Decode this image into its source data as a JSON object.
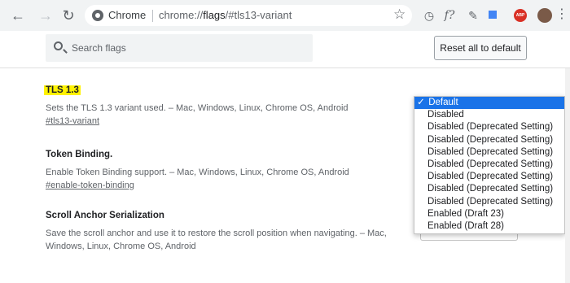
{
  "browser": {
    "site_name": "Chrome",
    "url_scheme": "chrome://",
    "url_host": "flags",
    "url_path": "/#tls13-variant",
    "extension_abp_label": "ABP"
  },
  "header": {
    "search_placeholder": "Search flags",
    "reset_label": "Reset all to default"
  },
  "flags": [
    {
      "title": "TLS 1.3",
      "description": "Sets the TLS 1.3 variant used. – Mac, Windows, Linux, Chrome OS, Android",
      "link": "#tls13-variant",
      "highlighted": true
    },
    {
      "title": "Token Binding.",
      "description": "Enable Token Binding support. – Mac, Windows, Linux, Chrome OS, Android",
      "link": "#enable-token-binding",
      "highlighted": false
    },
    {
      "title": "Scroll Anchor Serialization",
      "description_line1": "Save the scroll anchor and use it to restore the scroll position when navigating. – Mac,",
      "description_line2": "Windows, Linux, Chrome OS, Android",
      "highlighted": false
    }
  ],
  "dropdown": {
    "selected_check": "✓",
    "options": [
      "Default",
      "Disabled",
      "Disabled (Deprecated Setting)",
      "Disabled (Deprecated Setting)",
      "Disabled (Deprecated Setting)",
      "Disabled (Deprecated Setting)",
      "Disabled (Deprecated Setting)",
      "Disabled (Deprecated Setting)",
      "Disabled (Deprecated Setting)",
      "Enabled (Draft 23)",
      "Enabled (Draft 28)"
    ],
    "selected_index": 0
  },
  "colors": {
    "highlight": "#fff200",
    "selection": "#1a73e8",
    "abp": "#d93025"
  }
}
